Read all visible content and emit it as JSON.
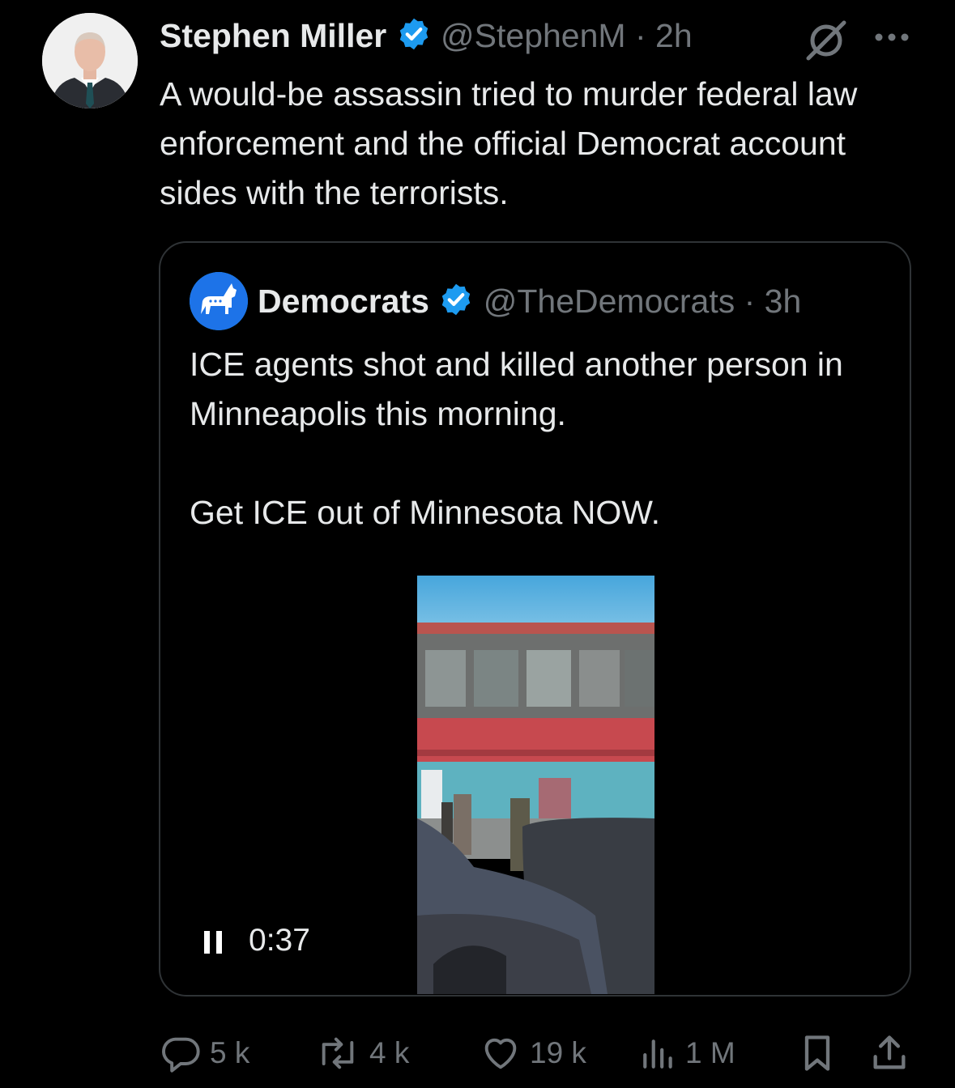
{
  "tweet": {
    "author_name": "Stephen Miller",
    "author_handle": "@StephenM",
    "time": "· 2h",
    "text": "A would-be assassin tried to murder federal law enforcement and the official Democrat account sides with the terrorists."
  },
  "quote": {
    "author_name": "Democrats",
    "author_handle": "@TheDemocrats",
    "time": "· 3h",
    "text_line1": "ICE agents shot and killed another person in Minneapolis this morning.",
    "text_line2": "Get ICE out of Minnesota NOW.",
    "video_time": "0:37"
  },
  "actions": {
    "replies": "5 k",
    "reposts": "4 k",
    "likes": "19 k",
    "views": "1 M"
  },
  "icons": [
    "verified-badge-icon",
    "grok-icon",
    "more-icon",
    "donkey-logo-icon",
    "pause-icon",
    "reply-icon",
    "repost-icon",
    "like-icon",
    "views-icon",
    "bookmark-icon",
    "share-icon"
  ],
  "colors": {
    "background": "#000000",
    "text": "#e7e9ea",
    "muted": "#71767b",
    "verified": "#1d9bf0",
    "border": "#2f3336"
  }
}
